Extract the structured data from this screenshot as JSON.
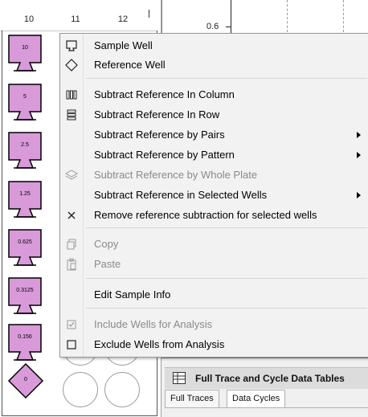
{
  "plate": {
    "column_headers": [
      "10",
      "11",
      "12"
    ],
    "sample_wells": [
      "10",
      "5",
      "2.5",
      "1.25",
      "0.625",
      "0.3125",
      "0.156"
    ],
    "reference_well": "0"
  },
  "chart": {
    "y_tick": "0.6"
  },
  "bottom_panel": {
    "title": "Full Trace and Cycle Data Tables",
    "tabs": [
      "Full Traces",
      "Data Cycles"
    ]
  },
  "menu": {
    "items": [
      {
        "label": "Sample Well",
        "icon": "sample-well-icon",
        "disabled": false,
        "submenu": false
      },
      {
        "label": "Reference Well",
        "icon": "diamond-icon",
        "disabled": false,
        "submenu": false
      },
      {
        "label": "Subtract Reference In Column",
        "icon": "columns-icon",
        "disabled": false,
        "submenu": false
      },
      {
        "label": "Subtract Reference In Row",
        "icon": "rows-icon",
        "disabled": false,
        "submenu": false
      },
      {
        "label": "Subtract Reference by Pairs",
        "icon": "",
        "disabled": false,
        "submenu": true
      },
      {
        "label": "Subtract Reference by Pattern",
        "icon": "",
        "disabled": false,
        "submenu": true
      },
      {
        "label": "Subtract Reference by Whole Plate",
        "icon": "layers-icon",
        "disabled": true,
        "submenu": false
      },
      {
        "label": "Subtract Reference in Selected Wells",
        "icon": "",
        "disabled": false,
        "submenu": true
      },
      {
        "label": "Remove reference subtraction for selected wells",
        "icon": "x-icon",
        "disabled": false,
        "submenu": false
      },
      {
        "label": "Copy",
        "icon": "copy-icon",
        "disabled": true,
        "submenu": false
      },
      {
        "label": "Paste",
        "icon": "paste-icon",
        "disabled": true,
        "submenu": false
      },
      {
        "label": "Edit Sample Info",
        "icon": "",
        "disabled": false,
        "submenu": false
      },
      {
        "label": "Include Wells for Analysis",
        "icon": "checked-box-icon",
        "disabled": true,
        "submenu": false
      },
      {
        "label": "Exclude Wells from Analysis",
        "icon": "empty-box-icon",
        "disabled": false,
        "submenu": false
      }
    ]
  },
  "colors": {
    "sample_fill": "#d99ad9",
    "menu_bg": "#f2f2f2",
    "disabled_text": "#8a8a8a"
  }
}
